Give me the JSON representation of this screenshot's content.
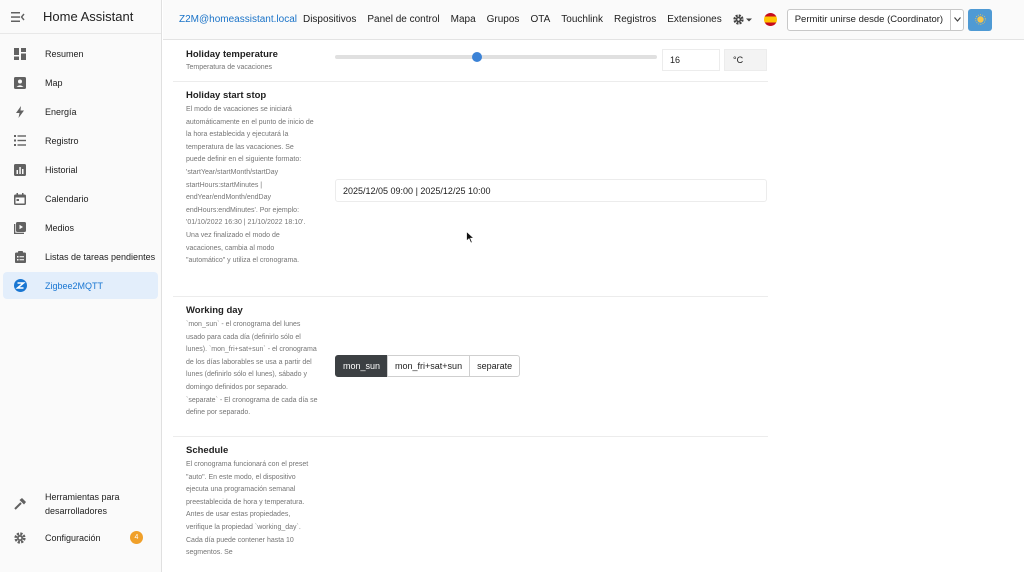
{
  "sidebar": {
    "title": "Home Assistant",
    "items": [
      {
        "label": "Resumen",
        "icon": "dashboard-icon"
      },
      {
        "label": "Map",
        "icon": "map-icon"
      },
      {
        "label": "Energía",
        "icon": "lightning-icon"
      },
      {
        "label": "Registro",
        "icon": "logbook-icon"
      },
      {
        "label": "Historial",
        "icon": "history-chart-icon"
      },
      {
        "label": "Calendario",
        "icon": "calendar-icon"
      },
      {
        "label": "Medios",
        "icon": "media-icon"
      },
      {
        "label": "Listas de tareas pendientes",
        "icon": "todo-list-icon"
      },
      {
        "label": "Zigbee2MQTT",
        "icon": "zigbee-icon"
      }
    ],
    "bottom": [
      {
        "label": "Herramientas para desarrolladores",
        "icon": "hammer-icon"
      },
      {
        "label": "Configuración",
        "icon": "settings-icon",
        "badge": "4"
      }
    ]
  },
  "topbar": {
    "brand": "Z2M@homeassistant.local",
    "nav": [
      "Dispositivos",
      "Panel de control",
      "Mapa",
      "Grupos",
      "OTA",
      "Touchlink",
      "Registros",
      "Extensiones"
    ],
    "permit_join": "Permitir unirse desde (Coordinator)",
    "accent": "#1a73c8"
  },
  "settings": {
    "holiday_temperature": {
      "title": "Holiday temperature",
      "desc": "Temperatura de vacaciones",
      "value": "16",
      "unit": "°C",
      "slider_fraction": 0.44
    },
    "holiday_start_stop": {
      "title": "Holiday start stop",
      "desc": "El modo de vacaciones se iniciará automáticamente en el punto de inicio de la hora establecida y ejecutará la temperatura de las vacaciones. Se puede definir en el siguiente formato: 'startYear/startMonth/startDay startHours:startMinutes | endYear/endMonth/endDay endHours:endMinutes'. Por ejemplo: '01/10/2022 16:30 | 21/10/2022 18:10'. Una vez finalizado el modo de vacaciones, cambia al modo \"automático\" y utiliza el cronograma.",
      "value": "2025/12/05 09:00 | 2025/12/25 10:00"
    },
    "working_day": {
      "title": "Working day",
      "desc": "`mon_sun` - el cronograma del lunes usado para cada día (definirlo sólo el lunes). `mon_fri+sat+sun` - el cronograma de los días laborables se usa a partir del lunes (definirlo sólo el lunes), sábado y domingo definidos por separado. `separate` - El cronograma de cada día se define por separado.",
      "options": [
        "mon_sun",
        "mon_fri+sat+sun",
        "separate"
      ],
      "selected": "mon_sun"
    },
    "schedule": {
      "title": "Schedule",
      "desc": "El cronograma funcionará con el preset \"auto\". En este modo, el dispositivo ejecuta una programación semanal preestablecida de hora y temperatura. Antes de usar estas propiedades, verifique la propiedad `working_day`. Cada día puede contener hasta 10 segmentos. Se"
    }
  }
}
